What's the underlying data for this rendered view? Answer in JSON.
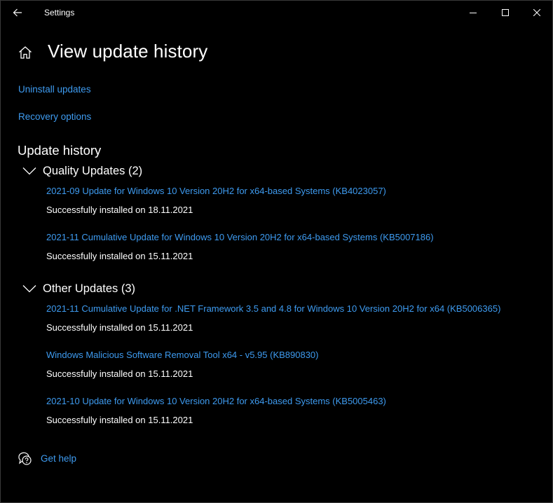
{
  "window": {
    "title": "Settings"
  },
  "header": {
    "title": "View update history"
  },
  "links": {
    "uninstall": "Uninstall updates",
    "recovery": "Recovery options"
  },
  "history": {
    "title": "Update history",
    "groups": [
      {
        "label": "Quality Updates (2)",
        "expanded": true,
        "items": [
          {
            "name": "2021-09 Update for Windows 10 Version 20H2 for x64-based Systems (KB4023057)",
            "status": "Successfully installed on 18.11.2021"
          },
          {
            "name": "2021-11 Cumulative Update for Windows 10 Version 20H2 for x64-based Systems (KB5007186)",
            "status": "Successfully installed on 15.11.2021"
          }
        ]
      },
      {
        "label": "Other Updates (3)",
        "expanded": true,
        "items": [
          {
            "name": "2021-11 Cumulative Update for .NET Framework 3.5 and 4.8 for Windows 10 Version 20H2 for x64 (KB5006365)",
            "status": "Successfully installed on 15.11.2021"
          },
          {
            "name": "Windows Malicious Software Removal Tool x64 - v5.95 (KB890830)",
            "status": "Successfully installed on 15.11.2021"
          },
          {
            "name": "2021-10 Update for Windows 10 Version 20H2 for x64-based Systems (KB5005463)",
            "status": "Successfully installed on 15.11.2021"
          }
        ]
      }
    ]
  },
  "help": {
    "label": "Get help"
  },
  "colors": {
    "background": "#000000",
    "text": "#ffffff",
    "link": "#3e9bf0"
  },
  "icons": {
    "back": "back-arrow-icon",
    "minimize": "minimize-icon",
    "maximize": "maximize-icon",
    "close": "close-icon",
    "home": "home-icon",
    "chevron": "chevron-down-icon",
    "help": "help-chat-icon"
  }
}
